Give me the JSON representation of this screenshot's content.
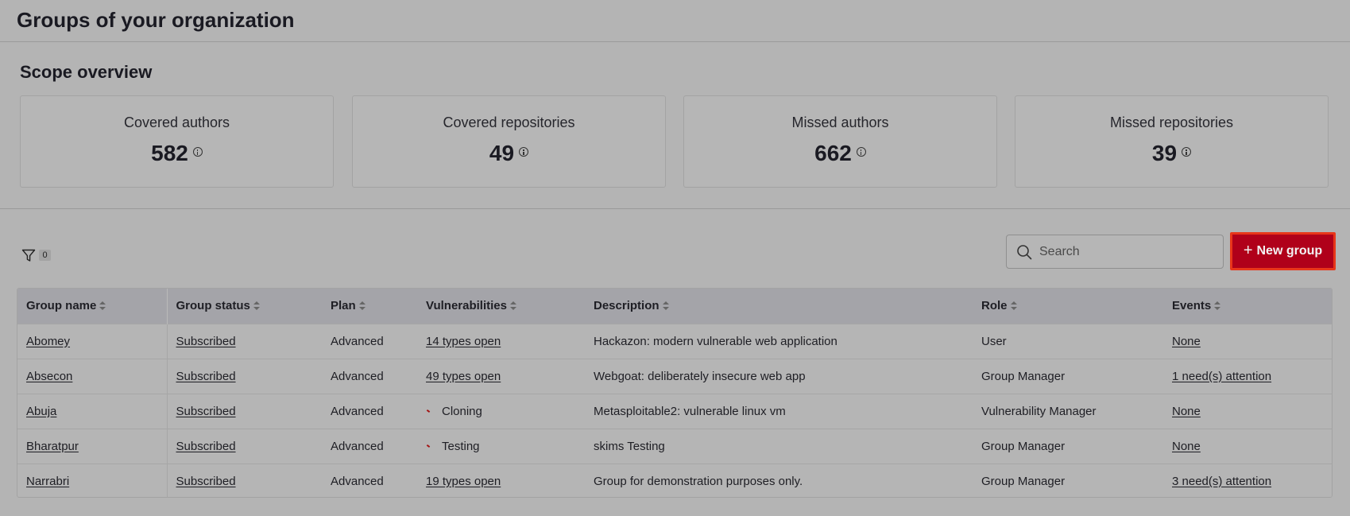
{
  "header": {
    "title": "Groups of your organization"
  },
  "scope": {
    "title": "Scope overview",
    "cards": [
      {
        "label": "Covered authors",
        "value": "582"
      },
      {
        "label": "Covered repositories",
        "value": "49"
      },
      {
        "label": "Missed authors",
        "value": "662"
      },
      {
        "label": "Missed repositories",
        "value": "39"
      }
    ]
  },
  "toolbar": {
    "filter_count": "0",
    "search_placeholder": "Search",
    "new_group_label": "New group"
  },
  "table": {
    "columns": [
      "Group name",
      "Group status",
      "Plan",
      "Vulnerabilities",
      "Description",
      "Role",
      "Events"
    ],
    "rows": [
      {
        "name": "Abomey",
        "status": "Subscribed",
        "plan": "Advanced",
        "vulnerabilities": "14 types open",
        "vuln_kind": "link",
        "description": "Hackazon: modern vulnerable web application",
        "role": "User",
        "events": "None"
      },
      {
        "name": "Absecon",
        "status": "Subscribed",
        "plan": "Advanced",
        "vulnerabilities": "49 types open",
        "vuln_kind": "link",
        "description": "Webgoat: deliberately insecure web app",
        "role": "Group Manager",
        "events": "1 need(s) attention"
      },
      {
        "name": "Abuja",
        "status": "Subscribed",
        "plan": "Advanced",
        "vulnerabilities": "Cloning",
        "vuln_kind": "status",
        "description": "Metasploitable2: vulnerable linux vm",
        "role": "Vulnerability Manager",
        "events": "None"
      },
      {
        "name": "Bharatpur",
        "status": "Subscribed",
        "plan": "Advanced",
        "vulnerabilities": "Testing",
        "vuln_kind": "status",
        "description": "skims Testing",
        "role": "Group Manager",
        "events": "None"
      },
      {
        "name": "Narrabri",
        "status": "Subscribed",
        "plan": "Advanced",
        "vulnerabilities": "19 types open",
        "vuln_kind": "link",
        "description": "Group for demonstration purposes only.",
        "role": "Group Manager",
        "events": "3 need(s) attention"
      }
    ]
  }
}
